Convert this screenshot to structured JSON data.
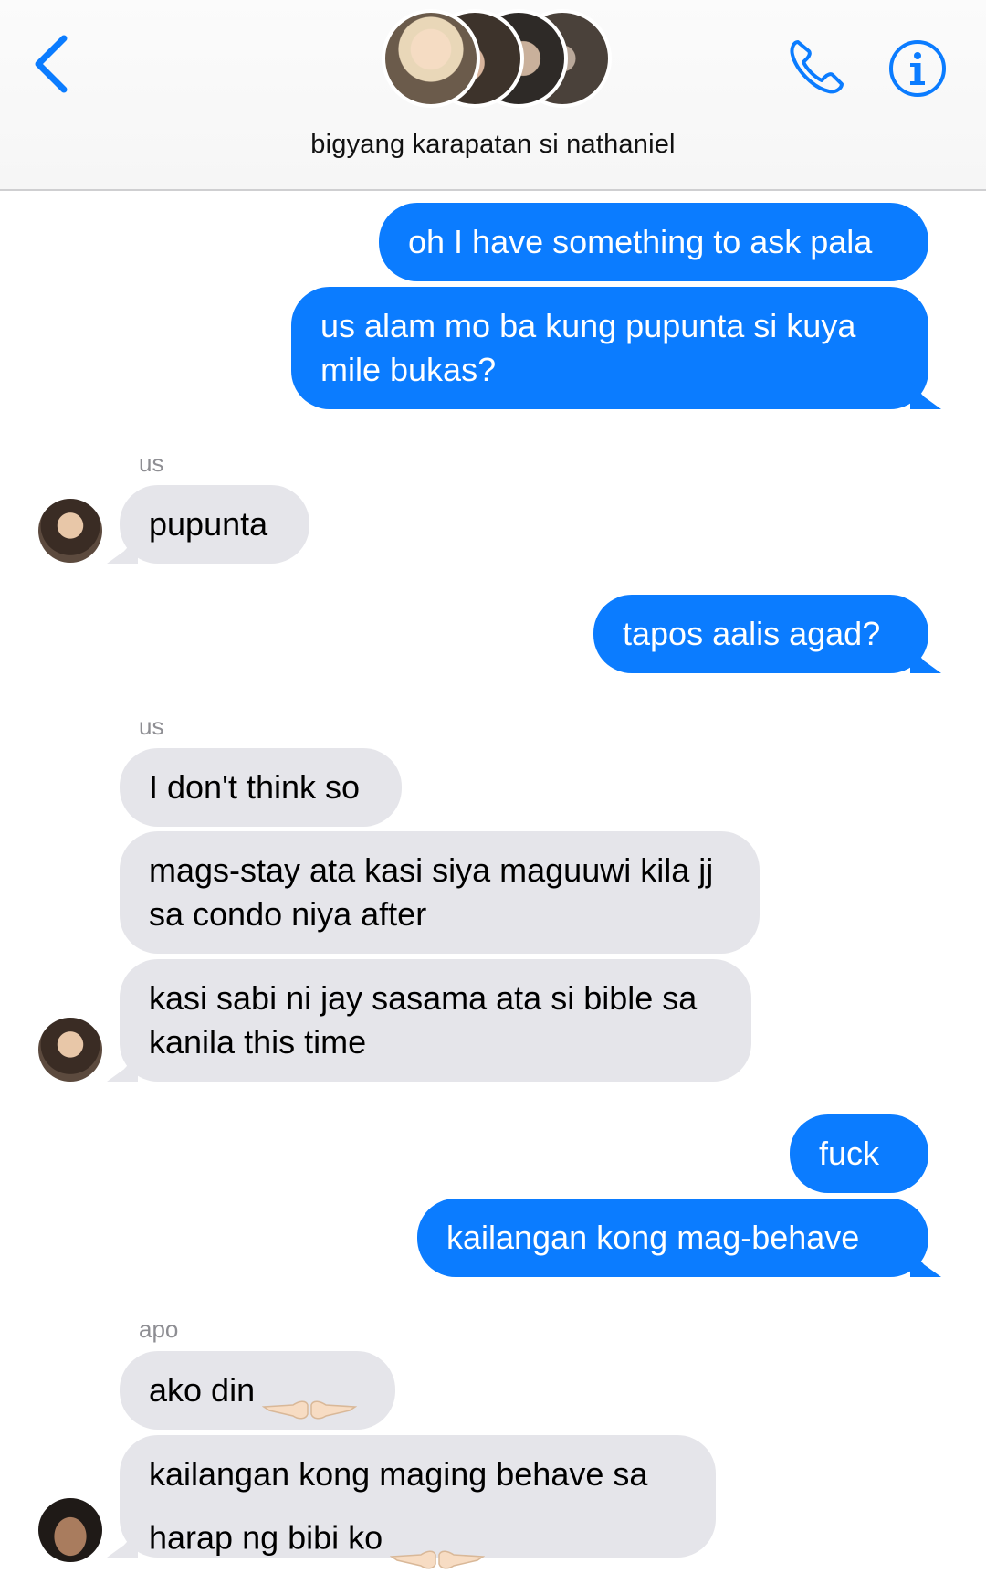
{
  "header": {
    "title": "bigyang karapatan si nathaniel",
    "back_icon": "chevron-left-icon",
    "call_icon": "phone-icon",
    "info_icon": "info-icon",
    "accent_color": "#0b7cff"
  },
  "messages": [
    {
      "direction": "outgoing",
      "text": "oh I have something to ask pala"
    },
    {
      "direction": "outgoing",
      "text": "us alam mo ba kung pupunta si kuya mile bukas?"
    },
    {
      "direction": "incoming",
      "sender": "us",
      "text": "pupunta"
    },
    {
      "direction": "outgoing",
      "text": "tapos aalis agad?"
    },
    {
      "direction": "incoming",
      "sender": "us",
      "text": "I don't think so"
    },
    {
      "direction": "incoming",
      "text": "mags-stay ata kasi siya maguuwi kila jj sa condo niya after"
    },
    {
      "direction": "incoming",
      "text": "kasi sabi ni jay sasama ata si bible sa kanila this time"
    },
    {
      "direction": "outgoing",
      "text": "fuck"
    },
    {
      "direction": "outgoing",
      "text": "kailangan kong mag-behave"
    },
    {
      "direction": "incoming",
      "sender": "apo",
      "text": "ako din"
    },
    {
      "direction": "incoming",
      "text": "kailangan kong maging behave sa harap ng bibi ko"
    }
  ],
  "senders": {
    "us": "us",
    "apo": "apo"
  },
  "colors": {
    "outgoing_bubble": "#0b7cff",
    "incoming_bubble": "#e5e5ea",
    "sender_label": "#8e8e93"
  }
}
